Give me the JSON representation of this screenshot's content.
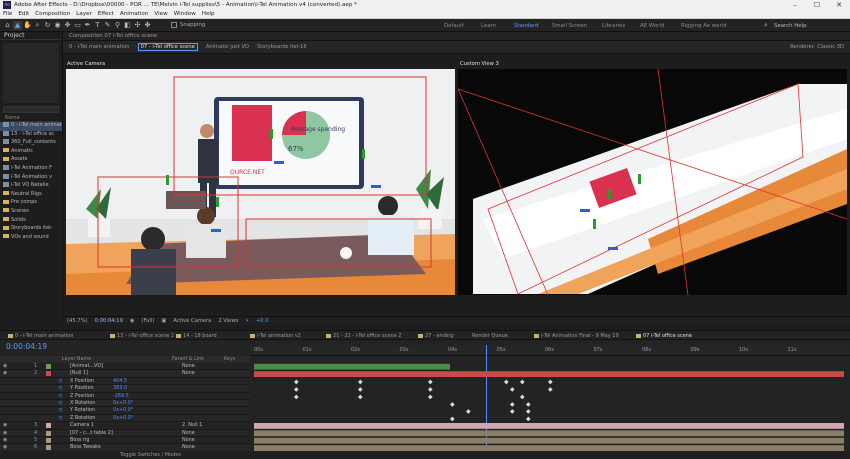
{
  "window": {
    "title": "Adobe After Effects - D:\\Dropbox\\00000 - POR ... TE\\Melvin i-Tel supplies\\5 - Animation\\i-Tel Animation v4 (converted).aep *",
    "controls": [
      "–",
      "☐",
      "✕"
    ]
  },
  "menu": [
    "File",
    "Edit",
    "Composition",
    "Layer",
    "Effect",
    "Animation",
    "View",
    "Window",
    "Help"
  ],
  "toolbar": {
    "snapping_label": "Snapping",
    "workspaces": [
      "Default",
      "Learn",
      "Standard",
      "Small Screen",
      "Libraries",
      "AE World",
      "Rigging Ae world"
    ],
    "active_workspace": "Standard",
    "search_help": "Search Help"
  },
  "project": {
    "title": "Project",
    "column_name": "Name",
    "items": [
      {
        "label": "0 - i-Tel main animation",
        "type": "comp"
      },
      {
        "label": "13 - i-Tel office sc",
        "type": "comp"
      },
      {
        "label": "360_Full_contents",
        "type": "comp"
      },
      {
        "label": "Animatic",
        "type": "folder"
      },
      {
        "label": "Assets",
        "type": "folder"
      },
      {
        "label": "i-Tel Animation F",
        "type": "comp"
      },
      {
        "label": "i-Tel Animation v",
        "type": "comp"
      },
      {
        "label": "i-Tel VO Natalie",
        "type": "comp"
      },
      {
        "label": "Neutral Rigs",
        "type": "folder"
      },
      {
        "label": "Pre comps",
        "type": "folder"
      },
      {
        "label": "Scenes",
        "type": "folder"
      },
      {
        "label": "Solids",
        "type": "folder"
      },
      {
        "label": "Storyboards itel-",
        "type": "folder"
      },
      {
        "label": "VOs and sound",
        "type": "folder"
      }
    ]
  },
  "composition": {
    "panel_label": "Composition 07 i-Tel office scene",
    "tabs": [
      "0 - i-Tel main animation",
      "07 - i-Tel office scene",
      "Animatic just VO",
      "Storyboards itel-16"
    ],
    "active_tab": "07 - i-Tel office scene",
    "renderer_label": "Renderer:",
    "renderer": "Classic 3D",
    "left_view": "Active Camera",
    "right_view": "Custom View 3",
    "chart_text": "Average spending",
    "chart_percent": "67%",
    "center_label": "OURCE.NET",
    "controls": {
      "zoom": "(45.7%)",
      "timecode": "0:00:04:19",
      "resolution": "(Full)",
      "camera": "Active Camera",
      "views": "2 Views",
      "exposure": "+0.0"
    }
  },
  "timeline": {
    "tabs": [
      {
        "label": "0 - i-Tel main animation",
        "color": "#c9b16a"
      },
      {
        "label": "13 - i-Tel office scene 2",
        "color": "#c9b16a"
      },
      {
        "label": "14 - 18 board",
        "color": "#c9b16a"
      },
      {
        "label": "i-Tel animation v2",
        "color": "#c9b16a"
      },
      {
        "label": "21 - 22 - i-Tel office scene 2",
        "color": "#c9b16a"
      },
      {
        "label": "27 - ending",
        "color": "#c9b16a"
      },
      {
        "label": "Render Queue",
        "color": "#c9b16a"
      },
      {
        "label": "i-Tel Animation Final - 9 May 19",
        "color": "#c9b16a"
      },
      {
        "label": "07 i-Tel office scene",
        "color": "#c9b16a"
      }
    ],
    "active_tab": "07 i-Tel office scene",
    "current_time": "0:00:04:19",
    "header": {
      "source": "Layer Name",
      "parent": "Parent & Link",
      "keys": "Keys"
    },
    "ruler": [
      "00s",
      "01s",
      "02s",
      "03s",
      "04s",
      "05s",
      "06s",
      "07s",
      "08s",
      "09s",
      "10s",
      "11s"
    ],
    "layers": [
      {
        "num": "1",
        "name": "[Animat...VO]",
        "value": "",
        "parent": "None",
        "color": "#6e9a5a"
      },
      {
        "num": "2",
        "name": "[Null 1]",
        "value": "",
        "parent": "None",
        "color": "#c94a4a"
      },
      {
        "num": "",
        "name": "X Position",
        "value": "404.5",
        "parent": "",
        "color": ""
      },
      {
        "num": "",
        "name": "Y Position",
        "value": "383.0",
        "parent": "",
        "color": ""
      },
      {
        "num": "",
        "name": "Z Position",
        "value": "-269.5",
        "parent": "",
        "color": ""
      },
      {
        "num": "",
        "name": "X Rotation",
        "value": "0x+0.0°",
        "parent": "",
        "color": ""
      },
      {
        "num": "",
        "name": "Y Rotation",
        "value": "0x+0.0°",
        "parent": "",
        "color": ""
      },
      {
        "num": "",
        "name": "Z Rotation",
        "value": "0x+0.0°",
        "parent": "",
        "color": ""
      },
      {
        "num": "3",
        "name": "Camera 1",
        "value": "",
        "parent": "2. Null 1",
        "color": "#d7a3b1"
      },
      {
        "num": "4",
        "name": "[07 - c...t table 2]",
        "value": "",
        "parent": "None",
        "color": "#a89a7c"
      },
      {
        "num": "5",
        "name": "Boss rig",
        "value": "",
        "parent": "None",
        "color": "#a89a7c"
      },
      {
        "num": "6",
        "name": "Boss Tweaks",
        "value": "",
        "parent": "None",
        "color": "#a89a7c"
      }
    ],
    "toggle_label": "Toggle Switches / Modes"
  },
  "colors": {
    "accent": "#5b9cff",
    "bg": "#1d1d1d",
    "wall_orange": "#e08a2a",
    "carpet": "#a98c80",
    "layer_green": "#4c8b48",
    "layer_pink": "#cfa7b3",
    "layer_tan": "#8b7e66"
  }
}
